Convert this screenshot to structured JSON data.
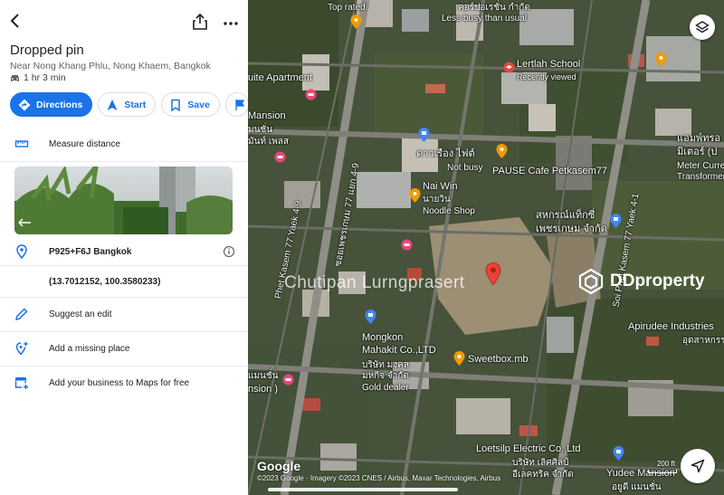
{
  "panel": {
    "title": "Dropped pin",
    "subtitle": "Near Nong Khang Phlu, Nong Khaem, Bangkok",
    "eta": "1 hr 3 min",
    "actions": {
      "directions": "Directions",
      "start": "Start",
      "save": "Save"
    },
    "rows": {
      "measure": "Measure distance",
      "plus_code": "P925+F6J Bangkok",
      "coordinates": "(13.7012152, 100.3580233)",
      "suggest_edit": "Suggest an edit",
      "add_place": "Add a missing place",
      "add_business": "Add your business to Maps for free"
    }
  },
  "map": {
    "labels": {
      "top_rated": "Top rated",
      "thai_top": "คอร์ปอเรชั่น กำกัด",
      "less_busy": "Less busy than usual",
      "lertlah": "Lertlah School",
      "recently_viewed": "Recently viewed",
      "apartment": "uite Apartment",
      "mansion": "Mansion",
      "thai_mansion": "มนชั่น",
      "thai_mansion2": "มันท์ เพลส",
      "ekatthai": "ดาวเรือง ไฟต์",
      "not_busy": "Not busy",
      "pause_cafe": "PAUSE Cafe Petkasem77",
      "nai_win": "Nai Win",
      "thai_naiwin": "นายวิน",
      "noodle": "Noodle Shop",
      "cooperative_th": "สหกรณ์แท็กซี่",
      "cooperative_th2": "เพชรเกษม จำกัด",
      "road_left": "Phet Kasem 77 Yaek 4-9",
      "road_left_th": "ซอยเพชรเกษม 77 แยก 4-9",
      "road_right": "Soi Phet Kasem 77 Yaek 4-1",
      "mongkon": "Mongkon",
      "mongkon2": "Mahakit Co.,LTD",
      "mongkon_th": "บริษัท มงคล",
      "mongkon_th2": "มหกิจ จำกัด",
      "gold_dealer": "Gold dealer",
      "sweetbox": "Sweetbox.mb",
      "apirudee": "Apirudee Industries",
      "apirudee_th": "อุดสาหกรรม",
      "mansion_left": "แมนชั่น",
      "mansion_left2": "nsion )",
      "loetsilp": "Loetsilp Electric Co.,Ltd",
      "loetsilp_th": "บริษัท เลิศศิลป์",
      "loetsilp_th2": "อีเลคทริค จำกัด",
      "yudee": "Yudee Mansion",
      "yudee_th": "อยูดี แมนชั่น",
      "meter_th": "แอมพ์ทรอ",
      "meter_th2": "มิเตอร์ (ป",
      "meter": "Meter Curre",
      "transformer": "Transformer"
    },
    "watermark": "Chutipan Lurngprasert",
    "brand": "DDproperty",
    "google": "Google",
    "attribution": "©2023 Google · Imagery ©2023 CNES / Airbus, Maxar Technologies, Airbus",
    "scale": "200 ft"
  }
}
